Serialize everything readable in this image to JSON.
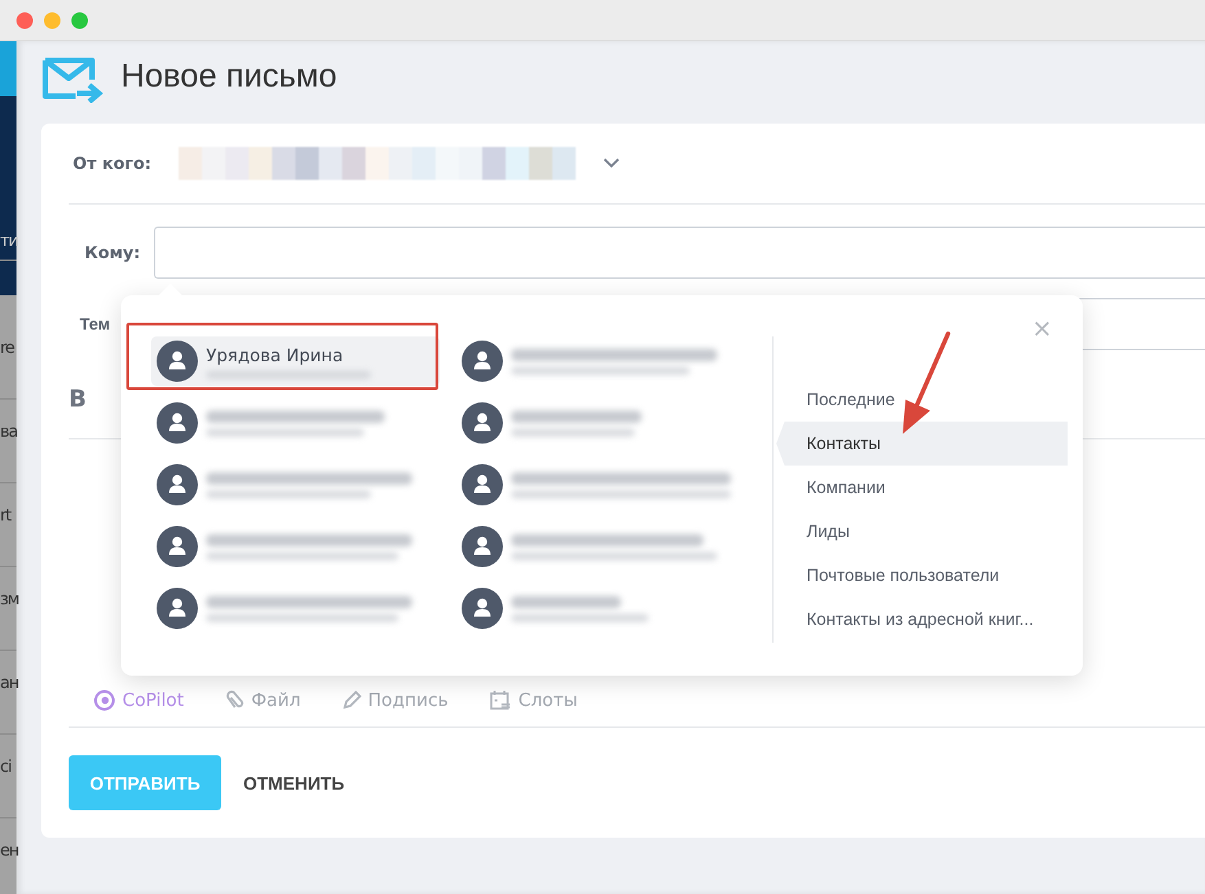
{
  "sidebar": {
    "items": [
      {
        "label": "ти"
      },
      {
        "label": "re"
      },
      {
        "label": "ва"
      },
      {
        "label": "rt"
      },
      {
        "label": "зм"
      },
      {
        "label": "ан"
      },
      {
        "label": "ci"
      },
      {
        "label": "ен"
      }
    ]
  },
  "header": {
    "title": "Новое письмо"
  },
  "form": {
    "from_label": "От кого:",
    "to_label": "Кому:",
    "subject_label": "Тем",
    "bold_button": "B"
  },
  "toolbar": [
    {
      "label": "CoPilot",
      "kind": "copilot"
    },
    {
      "label": "Файл",
      "kind": "file"
    },
    {
      "label": "Подпись",
      "kind": "signature"
    },
    {
      "label": "Слоты",
      "kind": "slots"
    }
  ],
  "actions": [
    {
      "label": "ОТПРАВИТЬ",
      "kind": "primary"
    },
    {
      "label": "ОТМЕНИТЬ",
      "kind": "secondary"
    }
  ],
  "picker": {
    "close": "×",
    "contacts": [
      {
        "kind": "named",
        "name": "Урядова Ирина",
        "selected": true
      },
      {
        "kind": "redacted",
        "selected": false
      },
      {
        "kind": "redacted",
        "selected": false
      },
      {
        "kind": "redacted",
        "selected": false
      },
      {
        "kind": "redacted",
        "selected": false
      },
      {
        "kind": "redacted",
        "selected": false
      },
      {
        "kind": "redacted",
        "selected": false
      },
      {
        "kind": "redacted",
        "selected": false
      },
      {
        "kind": "redacted",
        "selected": false
      },
      {
        "kind": "redacted",
        "selected": false
      }
    ],
    "categories": [
      {
        "label": "Последние",
        "selected": false
      },
      {
        "label": "Контакты",
        "selected": true
      },
      {
        "label": "Компании",
        "selected": false
      },
      {
        "label": "Лиды",
        "selected": false
      },
      {
        "label": "Почтовые пользователи",
        "selected": false
      },
      {
        "label": "Контакты из адресной книг...",
        "selected": false
      }
    ]
  }
}
